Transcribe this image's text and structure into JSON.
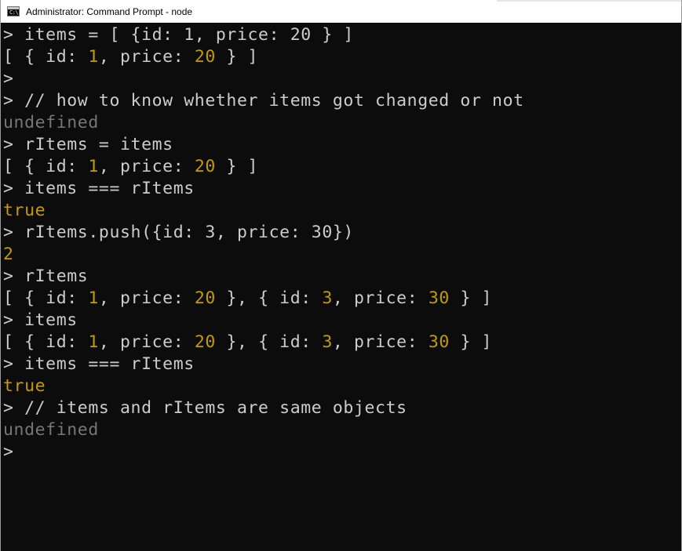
{
  "window": {
    "title": "Administrator: Command Prompt - node",
    "icon": "command-prompt-icon",
    "icon_glyph": "C:\\"
  },
  "colors": {
    "background": "#0c0c0c",
    "text": "#cccccc",
    "number": "#c19c00",
    "undefined": "#767676"
  },
  "console": {
    "lines": [
      [
        {
          "t": "> items = [ {id: 1, price: 20 } ]",
          "c": "text"
        }
      ],
      [
        {
          "t": "[ { id: ",
          "c": "text"
        },
        {
          "t": "1",
          "c": "num"
        },
        {
          "t": ", price: ",
          "c": "text"
        },
        {
          "t": "20",
          "c": "num"
        },
        {
          "t": " } ]",
          "c": "text"
        }
      ],
      [
        {
          "t": ">",
          "c": "text"
        }
      ],
      [
        {
          "t": "> // how to know whether items got changed or not",
          "c": "text"
        }
      ],
      [
        {
          "t": "undefined",
          "c": "undef"
        }
      ],
      [
        {
          "t": "> rItems = items",
          "c": "text"
        }
      ],
      [
        {
          "t": "[ { id: ",
          "c": "text"
        },
        {
          "t": "1",
          "c": "num"
        },
        {
          "t": ", price: ",
          "c": "text"
        },
        {
          "t": "20",
          "c": "num"
        },
        {
          "t": " } ]",
          "c": "text"
        }
      ],
      [
        {
          "t": "> items === rItems",
          "c": "text"
        }
      ],
      [
        {
          "t": "true",
          "c": "bool"
        }
      ],
      [
        {
          "t": "> rItems.push({id: 3, price: 30})",
          "c": "text"
        }
      ],
      [
        {
          "t": "2",
          "c": "num"
        }
      ],
      [
        {
          "t": "> rItems",
          "c": "text"
        }
      ],
      [
        {
          "t": "[ { id: ",
          "c": "text"
        },
        {
          "t": "1",
          "c": "num"
        },
        {
          "t": ", price: ",
          "c": "text"
        },
        {
          "t": "20",
          "c": "num"
        },
        {
          "t": " }, { id: ",
          "c": "text"
        },
        {
          "t": "3",
          "c": "num"
        },
        {
          "t": ", price: ",
          "c": "text"
        },
        {
          "t": "30",
          "c": "num"
        },
        {
          "t": " } ]",
          "c": "text"
        }
      ],
      [
        {
          "t": "> items",
          "c": "text"
        }
      ],
      [
        {
          "t": "[ { id: ",
          "c": "text"
        },
        {
          "t": "1",
          "c": "num"
        },
        {
          "t": ", price: ",
          "c": "text"
        },
        {
          "t": "20",
          "c": "num"
        },
        {
          "t": " }, { id: ",
          "c": "text"
        },
        {
          "t": "3",
          "c": "num"
        },
        {
          "t": ", price: ",
          "c": "text"
        },
        {
          "t": "30",
          "c": "num"
        },
        {
          "t": " } ]",
          "c": "text"
        }
      ],
      [
        {
          "t": "> items === rItems",
          "c": "text"
        }
      ],
      [
        {
          "t": "true",
          "c": "bool"
        }
      ],
      [
        {
          "t": "> // items and rItems are same objects",
          "c": "text"
        }
      ],
      [
        {
          "t": "undefined",
          "c": "undef"
        }
      ],
      [
        {
          "t": ">",
          "c": "text"
        }
      ]
    ]
  }
}
